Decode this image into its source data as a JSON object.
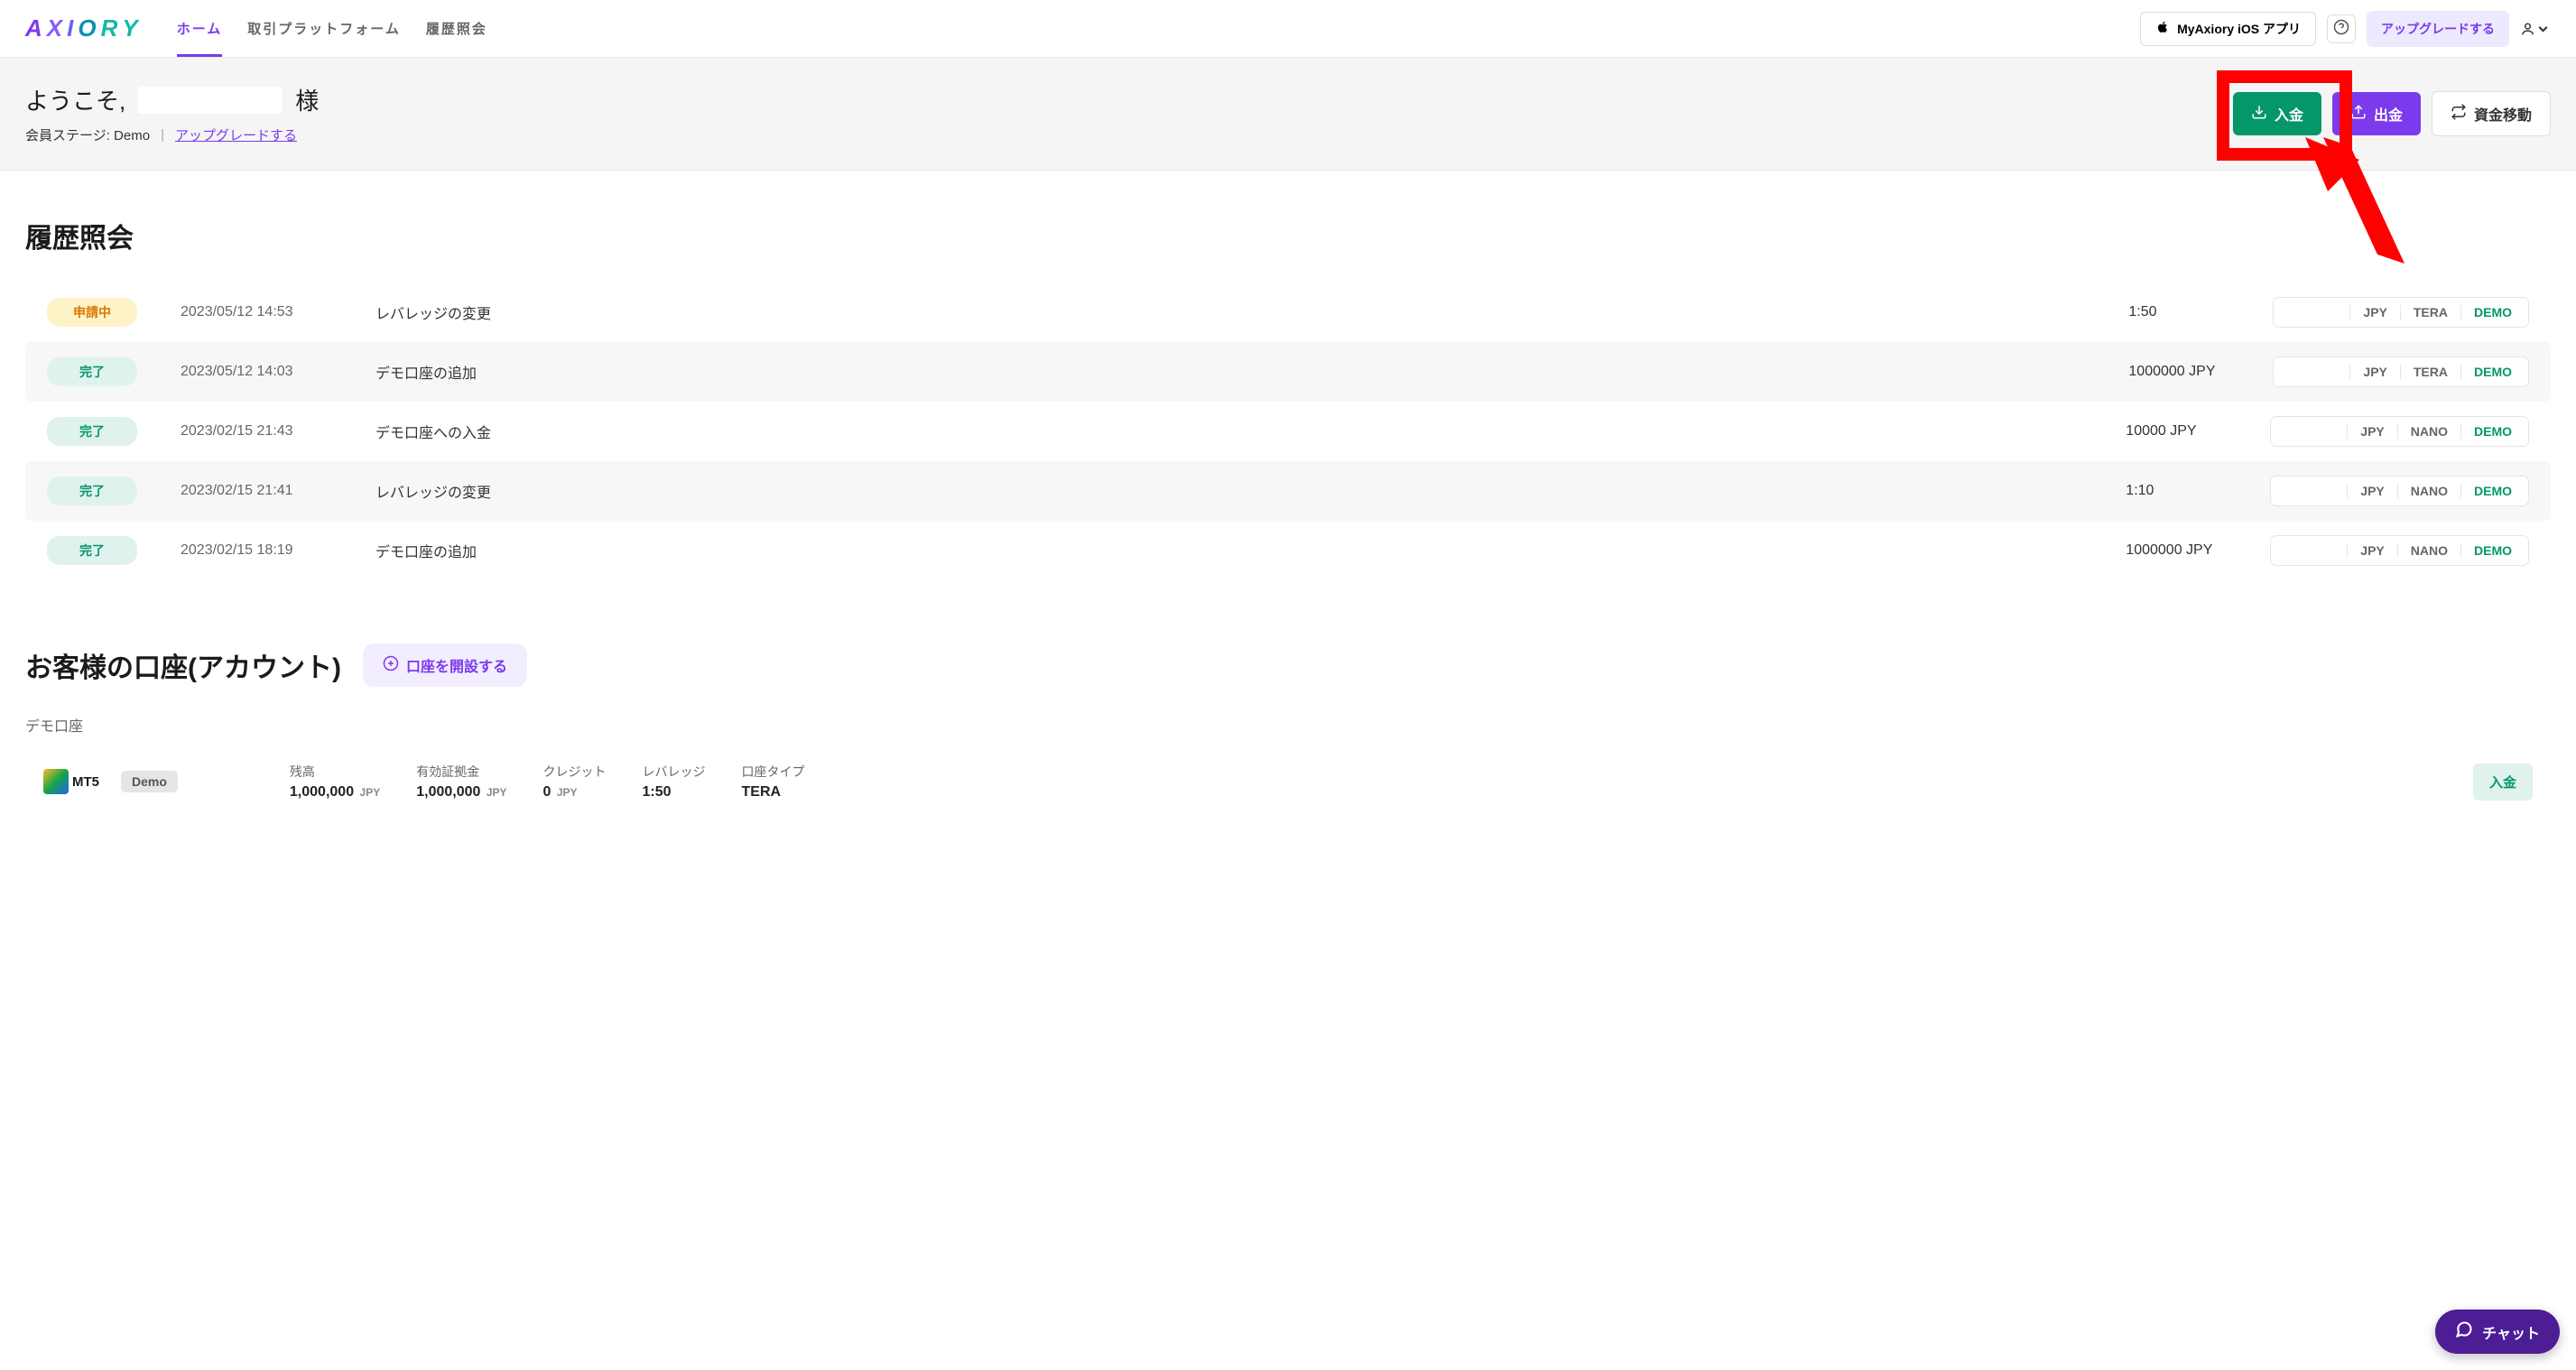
{
  "header": {
    "nav": {
      "home": "ホーム",
      "platform": "取引プラットフォーム",
      "history": "履歴照会"
    },
    "app_btn": "MyAxiory iOS アプリ",
    "upgrade_btn": "アップグレードする"
  },
  "welcome": {
    "prefix": "ようこそ,",
    "suffix": "様",
    "stage_label": "会員ステージ:",
    "stage_value": "Demo",
    "upgrade_link": "アップグレードする",
    "deposit": "入金",
    "withdraw": "出金",
    "transfer": "資金移動"
  },
  "history": {
    "title": "履歴照会",
    "rows": [
      {
        "status": "申請中",
        "status_cls": "pending",
        "date": "2023/05/12 14:53",
        "action": "レバレッジの変更",
        "value": "1:50",
        "currency": "JPY",
        "acct": "TERA",
        "mode": "DEMO"
      },
      {
        "status": "完了",
        "status_cls": "done",
        "date": "2023/05/12 14:03",
        "action": "デモ口座の追加",
        "value": "1000000 JPY",
        "currency": "JPY",
        "acct": "TERA",
        "mode": "DEMO"
      },
      {
        "status": "完了",
        "status_cls": "done",
        "date": "2023/02/15 21:43",
        "action": "デモ口座への入金",
        "value": "10000 JPY",
        "currency": "JPY",
        "acct": "NANO",
        "mode": "DEMO"
      },
      {
        "status": "完了",
        "status_cls": "done",
        "date": "2023/02/15 21:41",
        "action": "レバレッジの変更",
        "value": "1:10",
        "currency": "JPY",
        "acct": "NANO",
        "mode": "DEMO"
      },
      {
        "status": "完了",
        "status_cls": "done",
        "date": "2023/02/15 18:19",
        "action": "デモ口座の追加",
        "value": "1000000 JPY",
        "currency": "JPY",
        "acct": "NANO",
        "mode": "DEMO"
      }
    ]
  },
  "accounts": {
    "title": "お客様の口座(アカウント)",
    "open_btn": "口座を開設する",
    "type_label": "デモ口座",
    "deposit_btn": "入金",
    "row": {
      "platform": "MT5",
      "mode": "Demo",
      "stats": [
        {
          "label": "残高",
          "value": "1,000,000",
          "cur": "JPY"
        },
        {
          "label": "有効証拠金",
          "value": "1,000,000",
          "cur": "JPY"
        },
        {
          "label": "クレジット",
          "value": "0",
          "cur": "JPY"
        },
        {
          "label": "レバレッジ",
          "value": "1:50",
          "cur": ""
        },
        {
          "label": "口座タイプ",
          "value": "TERA",
          "cur": ""
        }
      ]
    }
  },
  "chat": {
    "label": "チャット"
  }
}
